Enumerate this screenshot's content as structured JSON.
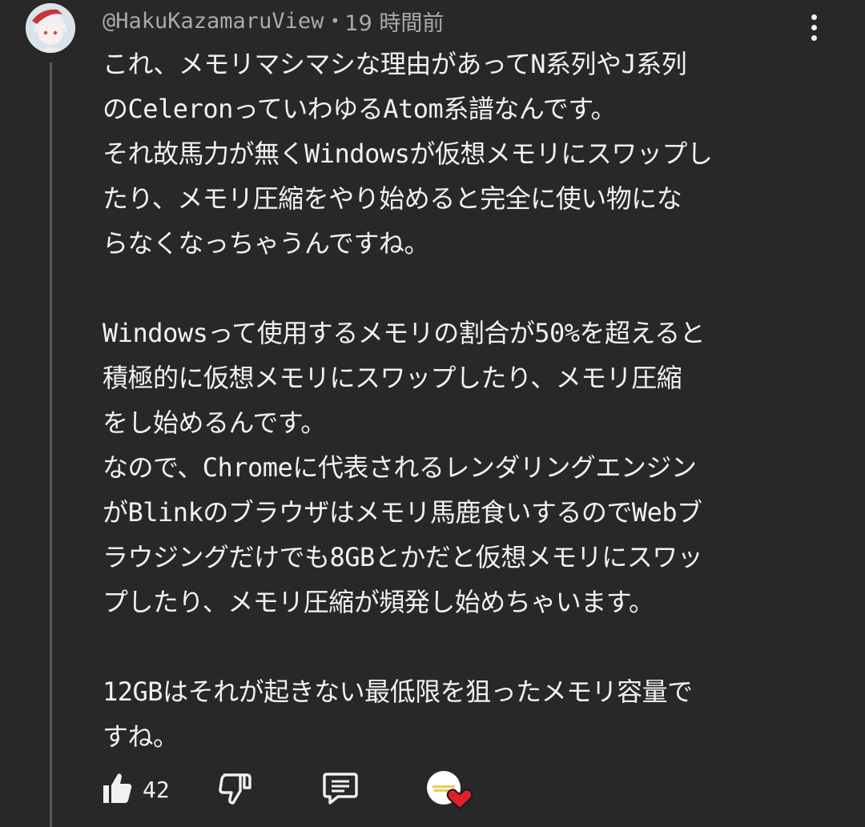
{
  "comment": {
    "author": "@HakuKazamaruView",
    "separator": "•",
    "timestamp": "19 時間前",
    "lines": [
      "これ、メモリマシマシな理由があってN系列やJ系列",
      "のCeleronっていわゆるAtom系譜なんです。",
      "それ故馬力が無くWindowsが仮想メモリにスワップし",
      "たり、メモリ圧縮をやり始めると完全に使い物にな",
      "らなくなっちゃうんですね。",
      "",
      "Windowsって使用するメモリの割合が50%を超えると",
      "積極的に仮想メモリにスワップしたり、メモリ圧縮",
      "をし始めるんです。",
      "なので、Chromeに代表されるレンダリングエンジン",
      "がBlinkのブラウザはメモリ馬鹿食いするのでWebブ",
      "ラウジングだけでも8GBとかだと仮想メモリにスワッ",
      "プしたり、メモリ圧縮が頻発し始めちゃいます。",
      "",
      "12GBはそれが起きない最低限を狙ったメモリ容量で",
      "すね。"
    ]
  },
  "actions": {
    "like_count": "42",
    "like_icon": "thumbs-up-icon",
    "dislike_icon": "thumbs-down-icon",
    "reply_icon": "reply-comment-icon",
    "creator_heart_icon": "creator-heart-icon"
  },
  "colors": {
    "background": "#282828",
    "text": "#f1f1f1",
    "meta_text": "#aaaaaa",
    "heart": "#e0202a"
  }
}
